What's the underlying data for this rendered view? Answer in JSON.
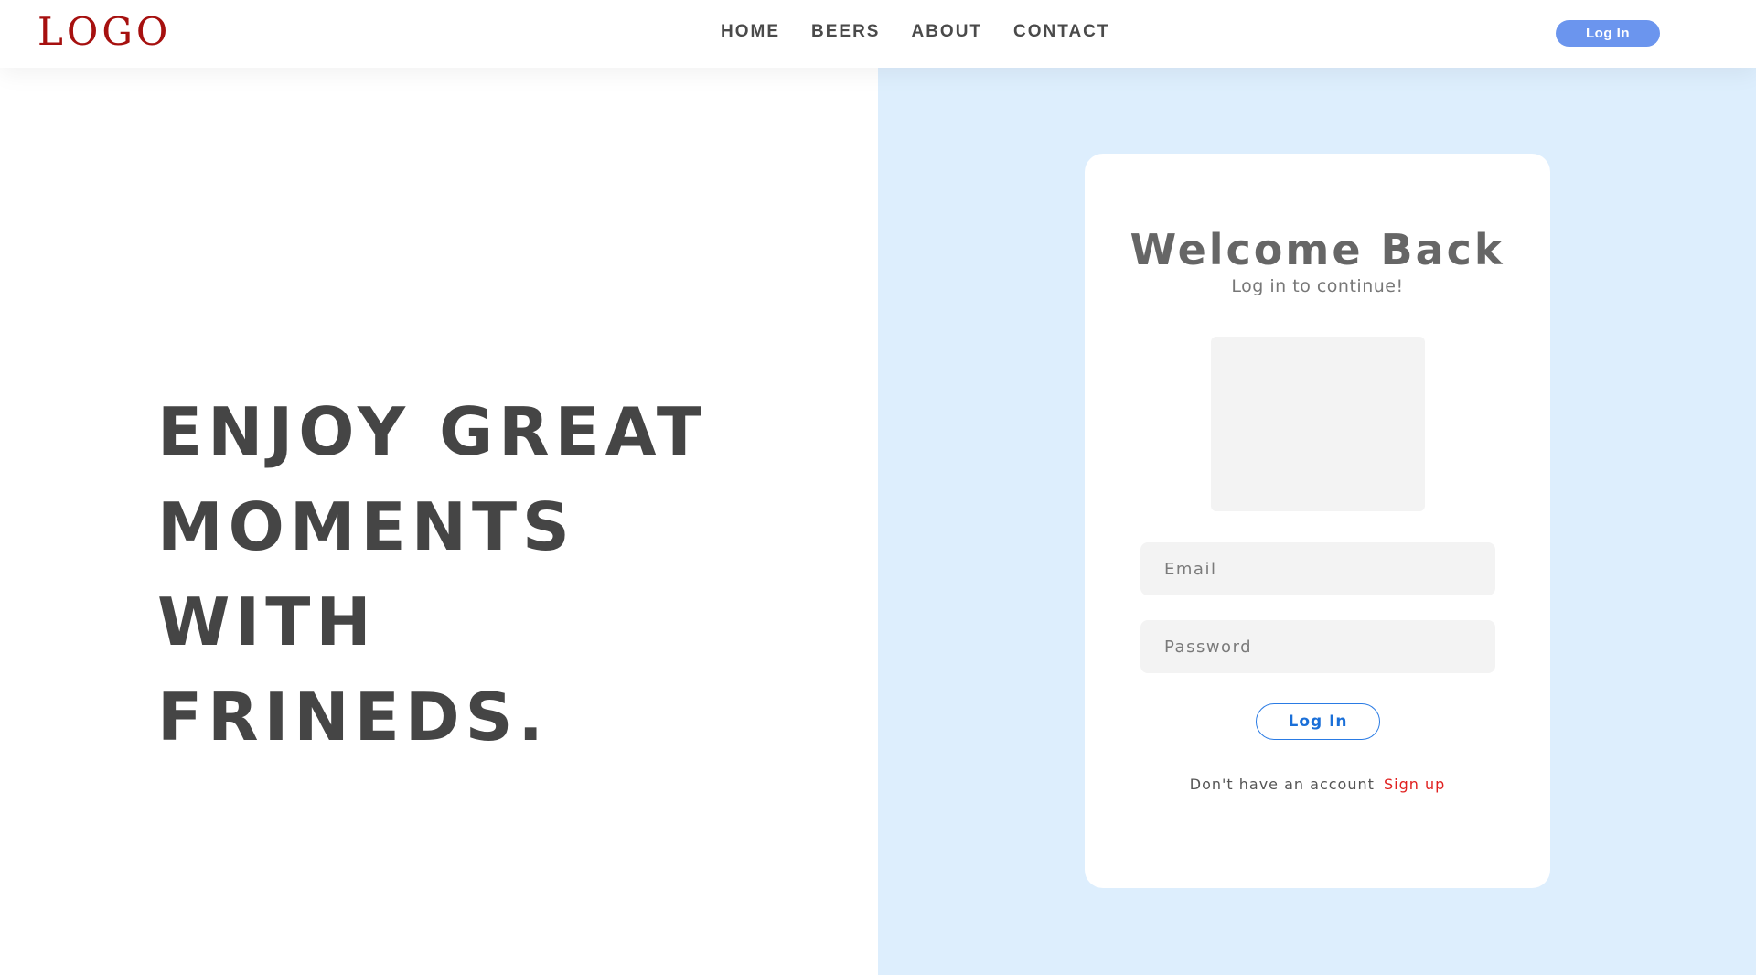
{
  "header": {
    "logo": "LOGO",
    "nav": [
      "HOME",
      "BEERS",
      "ABOUT",
      "CONTACT"
    ],
    "login_label": "Log In"
  },
  "hero": {
    "lines": [
      "ENJOY GREAT",
      "MOMENTS WITH",
      "FRINEDS."
    ]
  },
  "login_card": {
    "title": "Welcome Back",
    "subtitle": "Log in to continue!",
    "email_placeholder": "Email",
    "password_placeholder": "Password",
    "submit_label": "Log In",
    "no_account_text": "Don't have an account",
    "signup_label": "Sign up"
  },
  "colors": {
    "logo": "#a6100f",
    "nav_button": "#6b95ee",
    "right_background": "#ddeefd",
    "login_button_border": "#2a7be4",
    "signup_link": "#e0201f"
  }
}
